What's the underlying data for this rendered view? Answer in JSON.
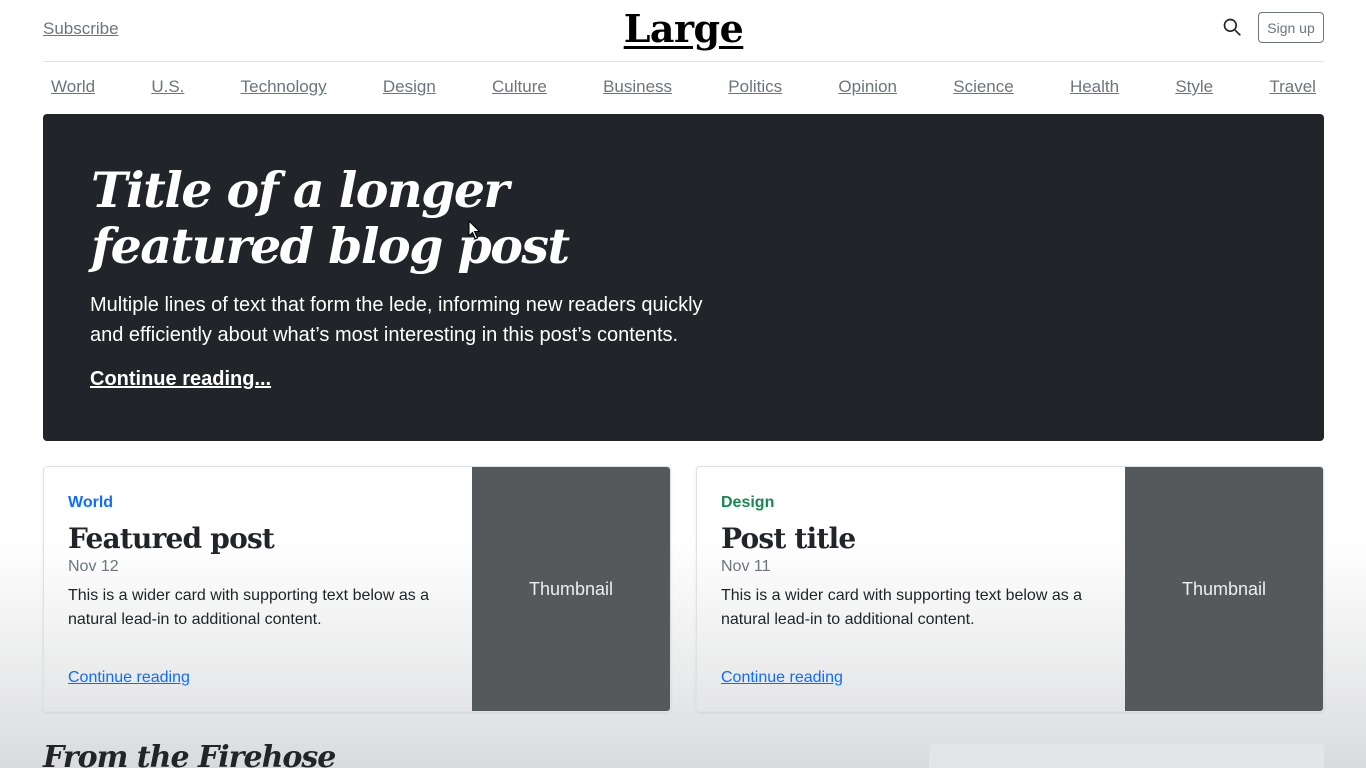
{
  "header": {
    "subscribe_label": "Subscribe",
    "logo": "Large",
    "signup_label": "Sign up"
  },
  "nav": {
    "items": [
      "World",
      "U.S.",
      "Technology",
      "Design",
      "Culture",
      "Business",
      "Politics",
      "Opinion",
      "Science",
      "Health",
      "Style",
      "Travel"
    ]
  },
  "hero": {
    "title": "Title of a longer featured blog post",
    "lede": "Multiple lines of text that form the lede, informing new readers quickly and efficiently about what’s most interesting in this post’s contents.",
    "link": "Continue reading..."
  },
  "cards": [
    {
      "category": "World",
      "title": "Featured post",
      "date": "Nov 12",
      "text": "This is a wider card with supporting text below as a natural lead-in to additional content.",
      "link": "Continue reading",
      "thumbnail": "Thumbnail"
    },
    {
      "category": "Design",
      "title": "Post title",
      "date": "Nov 11",
      "text": "This is a wider card with supporting text below as a natural lead-in to additional content.",
      "link": "Continue reading",
      "thumbnail": "Thumbnail"
    }
  ],
  "section": {
    "firehose_title": "From the Firehose"
  },
  "colors": {
    "hero_bg": "#212529",
    "thumbnail_bg": "#55595c",
    "world": "#0d6efd",
    "design": "#198754"
  }
}
